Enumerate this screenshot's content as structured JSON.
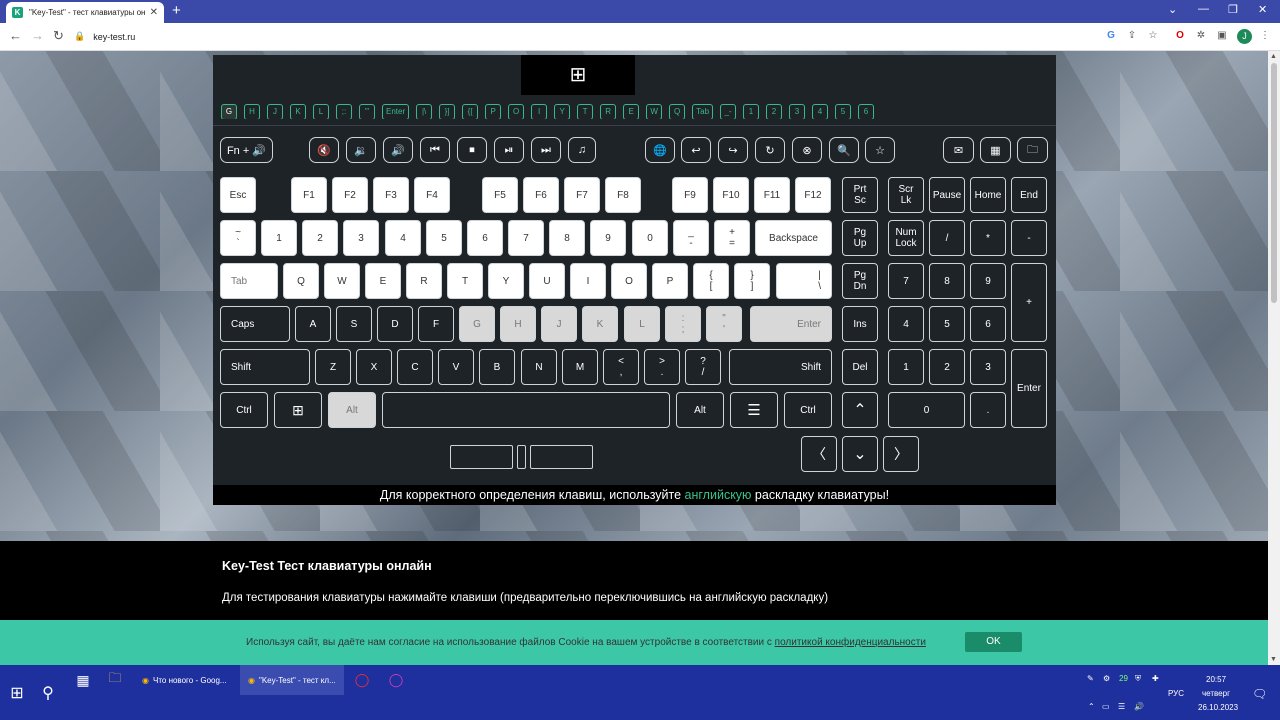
{
  "browser": {
    "tab_title": "\"Key-Test\" - тест клавиатуры он",
    "tab_favicon": "K",
    "tab_close": "✕",
    "new_tab": "+",
    "url": "key-test.ru",
    "avatar": "J",
    "ctl_min": "—",
    "ctl_max": "❐",
    "ctl_close": "✕",
    "ctl_chevron": "⌄"
  },
  "keyboard": {
    "os_windows": "⊞",
    "os_apple": "",
    "history": [
      "G",
      "H",
      "J",
      "K",
      "L",
      ";:",
      "\"'",
      "Enter",
      "|\\",
      "}]",
      "{[",
      "P",
      "O",
      "I",
      "Y",
      "T",
      "R",
      "E",
      "W",
      "Q",
      "Tab",
      "_-",
      "1",
      "2",
      "3",
      "4",
      "5",
      "6"
    ],
    "media": {
      "fn": "Fn + 🔊",
      "mute": "🔇",
      "vol_down": "🔉",
      "vol_up": "🔊",
      "prev": "⏮",
      "stop": "⏹",
      "play": "⏯",
      "next": "⏭",
      "music": "♫",
      "web": "🌐",
      "back": "↩",
      "forward": "↪",
      "refresh": "↻",
      "cancel": "⊗",
      "search": "🔍",
      "favorite": "☆",
      "mail": "✉",
      "calc": "▦",
      "folder": "🗀"
    },
    "fn_row": {
      "esc": "Esc",
      "f1": "F1",
      "f2": "F2",
      "f3": "F3",
      "f4": "F4",
      "f5": "F5",
      "f6": "F6",
      "f7": "F7",
      "f8": "F8",
      "f9": "F9",
      "f10": "F10",
      "f11": "F11",
      "f12": "F12",
      "prtsc": "Prt\nSc",
      "scrlk": "Scr\nLk",
      "pause": "Pause",
      "home": "Home",
      "end": "End"
    },
    "num_row": {
      "tilde": "~\n`",
      "n1": "1",
      "n2": "2",
      "n3": "3",
      "n4": "4",
      "n5": "5",
      "n6": "6",
      "n7": "7",
      "n8": "8",
      "n9": "9",
      "n0": "0",
      "minus": "_\n-",
      "plus": "+\n=",
      "backspace": "Backspace",
      "pgup": "Pg\nUp",
      "numlock": "Num\nLock",
      "div": "/",
      "mul": "*",
      "sub": "-"
    },
    "tab_row": {
      "tab": "Tab",
      "q": "Q",
      "w": "W",
      "e": "E",
      "r": "R",
      "t": "T",
      "y": "Y",
      "u": "U",
      "i": "I",
      "o": "O",
      "p": "P",
      "lbr": "{\n[",
      "rbr": "}\n]",
      "bslash": "|\n\\",
      "pgdn": "Pg\nDn",
      "np7": "7",
      "np8": "8",
      "np9": "9",
      "npplus": "+"
    },
    "caps_row": {
      "caps": "Caps",
      "a": "A",
      "s": "S",
      "d": "D",
      "f": "F",
      "g": "G",
      "h": "H",
      "j": "J",
      "k": "K",
      "l": "L",
      "semi": ":\n;",
      "quote": "\"\n'",
      "enter": "Enter",
      "ins": "Ins",
      "np4": "4",
      "np5": "5",
      "np6": "6"
    },
    "shift_row": {
      "lshift": "Shift",
      "z": "Z",
      "x": "X",
      "c": "C",
      "v": "V",
      "b": "B",
      "n": "N",
      "m": "M",
      "comma": "<\n,",
      "period": ">\n.",
      "slash": "?\n/",
      "rshift": "Shift",
      "del": "Del",
      "np1": "1",
      "np2": "2",
      "np3": "3",
      "npenter": "Enter"
    },
    "ctrl_row": {
      "lctrl": "Ctrl",
      "win": "⊞",
      "lalt": "Alt",
      "ralt": "Alt",
      "menu": "☰",
      "rctrl": "Ctrl",
      "up": "⌃",
      "np0": "0",
      "npdot": "."
    },
    "arrows": {
      "left": "〈",
      "down": "⌄",
      "right": "〉"
    },
    "caption_pre": "Для корректного определения клавиш, используйте ",
    "caption_en": "английскую",
    "caption_post": " раскладку клавиатуры!"
  },
  "info": {
    "title": "Key-Test Тест клавиатуры онлайн",
    "text": "Для тестирования клавиатуры нажимайте клавиши (предварительно переключившись на английскую раскладку)"
  },
  "cookie": {
    "text": "Используя сайт, вы даёте нам согласие на использование файлов Cookie на вашем устройстве в соответствии с ",
    "link": "политикой конфиденциальности",
    "ok": "OK"
  },
  "taskbar": {
    "start": "⊞",
    "search": "⚲",
    "item1": "Что нового - Goog...",
    "item2": "\"Key-Test\" - тест кл...",
    "lang": "РУС",
    "time": "20:57",
    "weekday": "четверг",
    "date": "26.10.2023",
    "tray_count": "29"
  }
}
